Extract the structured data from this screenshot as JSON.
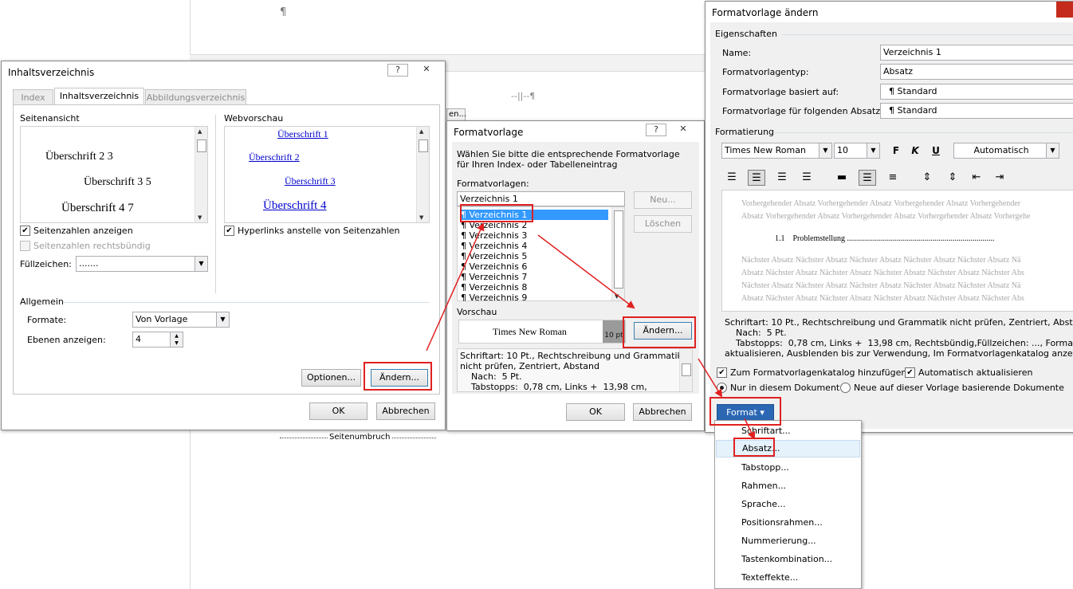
{
  "document": {
    "pilcrow_top": "¶",
    "marker": "--||--¶",
    "page_break": "Seitenumbruch",
    "tab_fragment": "en..."
  },
  "toc_dialog": {
    "title": "Inhaltsverzeichnis",
    "help": "?",
    "close": "✕",
    "tabs": [
      "Index",
      "Inhaltsverzeichnis",
      "Abbildungsverzeichnis"
    ],
    "page_view_label": "Seitenansicht",
    "page_view_lines": [
      "Überschrift 2 3",
      "Überschrift 3 5",
      "Überschrift 4 7"
    ],
    "web_preview_label": "Webvorschau",
    "web_preview_lines": [
      "Überschrift 1",
      "Überschrift 2",
      "Überschrift 3",
      "Überschrift 4"
    ],
    "show_page_numbers": "Seitenzahlen anzeigen",
    "align_right": "Seitenzahlen rechtsbündig",
    "hyperlinks": "Hyperlinks anstelle von Seitenzahlen",
    "tab_leader_label": "Füllzeichen:",
    "tab_leader_value": ".......",
    "general_label": "Allgemein",
    "formats_label": "Formate:",
    "formats_value": "Von Vorlage",
    "levels_label": "Ebenen anzeigen:",
    "levels_value": "4",
    "options_button": "Optionen...",
    "modify_button": "Ändern...",
    "ok_button": "OK",
    "cancel_button": "Abbrechen"
  },
  "style_dialog": {
    "title": "Formatvorlage",
    "help": "?",
    "close": "✕",
    "instruction": "Wählen Sie bitte die entsprechende Formatvorlage für Ihren Index- oder Tabelleneintrag",
    "styles_label": "Formatvorlagen:",
    "styles_input": "Verzeichnis 1",
    "styles_list": [
      "Verzeichnis 1",
      "Verzeichnis 2",
      "Verzeichnis 3",
      "Verzeichnis 4",
      "Verzeichnis 5",
      "Verzeichnis 6",
      "Verzeichnis 7",
      "Verzeichnis 8",
      "Verzeichnis 9"
    ],
    "pilcrow": "¶",
    "new_button": "Neu...",
    "delete_button": "Löschen",
    "preview_label": "Vorschau",
    "preview_font": "Times New Roman",
    "preview_size": "10 pt",
    "modify_button": "Ändern...",
    "description": [
      "Schriftart: 10 Pt., Rechtschreibung und Grammatik",
      "nicht prüfen, Zentriert, Abstand",
      "    Nach:  5 Pt.",
      "    Tabstopps:  0,78 cm, Links +  13,98 cm,"
    ],
    "ok_button": "OK",
    "cancel_button": "Abbrechen"
  },
  "modify_dialog": {
    "title": "Formatvorlage ändern",
    "properties_label": "Eigenschaften",
    "name_label": "Name:",
    "name_value": "Verzeichnis 1",
    "type_label": "Formatvorlagentyp:",
    "type_value": "Absatz",
    "based_label": "Formatvorlage basiert auf:",
    "based_value": "¶  Standard",
    "next_label": "Formatvorlage für folgenden Absatz:",
    "next_value": "¶  Standard",
    "formatting_label": "Formatierung",
    "font_value": "Times New Roman",
    "size_value": "10",
    "bold": "F",
    "italic": "K",
    "underline": "U",
    "color_value": "Automatisch",
    "preview_prev": [
      "Vorhergehender Absatz Vorhergehender Absatz Vorhergehender Absatz Vorhergehender",
      "Absatz Vorhergehender Absatz Vorhergehender Absatz Vorhergehender Absatz Vorhergehe"
    ],
    "preview_sample": "1.1    Problemstellung ..........................................................................",
    "preview_next": [
      "Nächster Absatz Nächster Absatz Nächster Absatz Nächster Absatz Nächster Absatz Nä",
      "Absatz Nächster Absatz Nächster Absatz Nächster Absatz Nächster Absatz Nächster Abs",
      "Nächster Absatz Nächster Absatz Nächster Absatz Nächster Absatz Nächster Absatz Nä",
      "Absatz Nächster Absatz Nächster Absatz Nächster Absatz Nächster Absatz Nächster Abs"
    ],
    "description": [
      "Schriftart: 10 Pt., Rechtschreibung und Grammatik nicht prüfen, Zentriert, Abstand",
      "    Nach:  5 Pt.",
      "    Tabstopps:  0,78 cm, Links +  13,98 cm, Rechtsbündig,Füllzeichen: ..., Formatvorlage",
      "aktualisieren, Ausblenden bis zur Verwendung, Im Formatvorlagenkatalog anzeigen, Pri"
    ],
    "add_gallery": "Zum Formatvorlagenkatalog hinzufügen",
    "auto_update": "Automatisch aktualisieren",
    "only_doc": "Nur in diesem Dokument",
    "new_docs": "Neue auf dieser Vorlage basierende Dokumente",
    "format_button": "Format ▾"
  },
  "format_menu": {
    "items": [
      "Schriftart...",
      "Absatz...",
      "Tabstopp...",
      "Rahmen...",
      "Sprache...",
      "Positionsrahmen...",
      "Nummerierung...",
      "Tastenkombination...",
      "Texteffekte..."
    ]
  },
  "colors": {
    "annotation_red": "#e02020",
    "selection_blue": "#3399ff",
    "link_blue": "#0000cc"
  }
}
